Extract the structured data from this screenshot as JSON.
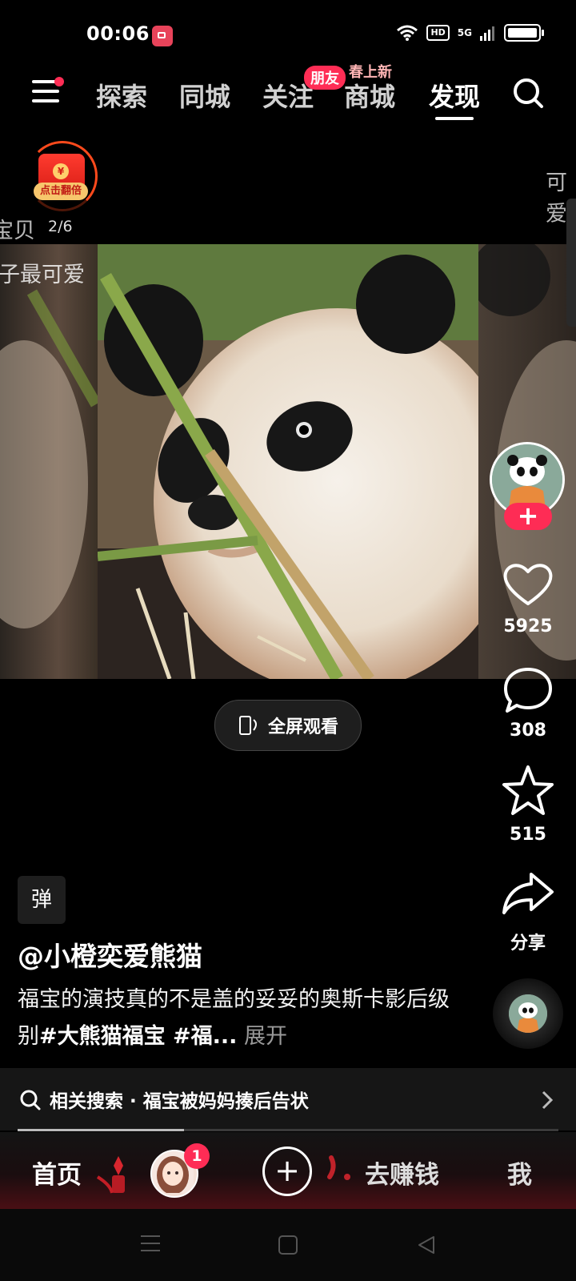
{
  "status_bar": {
    "time": "00:06",
    "hd": "HD",
    "network": "5G"
  },
  "top_nav": {
    "tabs": [
      "探索",
      "同城",
      "关注",
      "商城",
      "发现"
    ],
    "active_tab": "发现",
    "friends_badge": "朋友",
    "mall_badge": "春上新"
  },
  "red_packet": {
    "label": "点击翻倍",
    "coin": "¥",
    "progress": "2/6"
  },
  "side_peek": {
    "left_top": "宝贝",
    "left_bottom": "子最可爱",
    "right_top": "可爱"
  },
  "fullscreen_button": "全屏观看",
  "right_rail": {
    "likes": "5925",
    "comments": "308",
    "favorites": "515",
    "share": "分享",
    "follow": "+"
  },
  "caption": {
    "author": "@小橙奕爱熊猫",
    "text": "福宝的演技真的不是盖的妥妥的奥斯卡影后级别",
    "hashtags": "#大熊猫福宝 #福...",
    "expand": "展开",
    "music_badge": "弹"
  },
  "related_search": {
    "label": "相关搜索 · 福宝被妈妈揍后告状"
  },
  "bottom_tabs": {
    "home": "首页",
    "notification_count": "1",
    "create": "+",
    "earn": "去赚钱",
    "me": "我"
  },
  "colors": {
    "accent": "#fe2c55",
    "background": "#000000",
    "red_packet": "#ff3b2f"
  }
}
